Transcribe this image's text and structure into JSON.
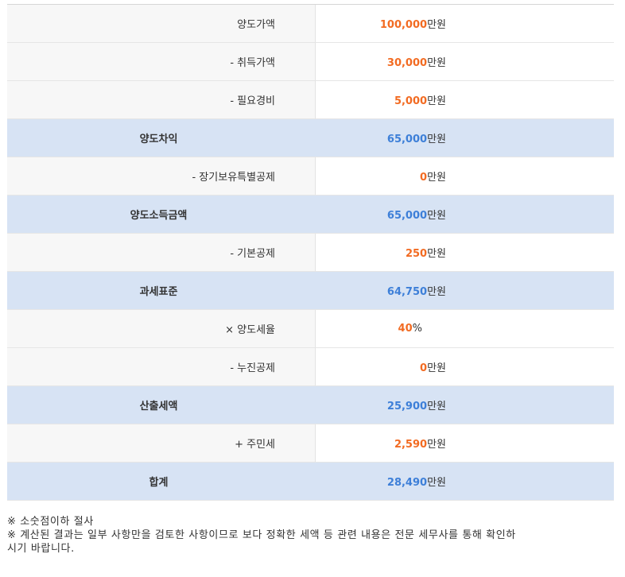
{
  "rows": [
    {
      "label": "양도가액",
      "value": "100,000",
      "unit": "만원",
      "color": "#f26b22",
      "summary": false
    },
    {
      "label": "- 취득가액",
      "value": "30,000",
      "unit": "만원",
      "color": "#f26b22",
      "summary": false
    },
    {
      "label": "- 필요경비",
      "value": "5,000",
      "unit": "만원",
      "color": "#f26b22",
      "summary": false
    },
    {
      "label": "양도차익",
      "value": "65,000",
      "unit": "만원",
      "color": "#3d7fd8",
      "summary": true
    },
    {
      "label": "- 장기보유특별공제",
      "value": "0",
      "unit": "만원",
      "color": "#f26b22",
      "summary": false
    },
    {
      "label": "양도소득금액",
      "value": "65,000",
      "unit": "만원",
      "color": "#3d7fd8",
      "summary": true
    },
    {
      "label": "- 기본공제",
      "value": "250",
      "unit": "만원",
      "color": "#f26b22",
      "summary": false
    },
    {
      "label": "과세표준",
      "value": "64,750",
      "unit": "만원",
      "color": "#3d7fd8",
      "summary": true
    },
    {
      "label": "× 양도세율",
      "value": "40",
      "unit": "%",
      "color": "#f26b22",
      "summary": false
    },
    {
      "label": "- 누진공제",
      "value": "0",
      "unit": "만원",
      "color": "#f26b22",
      "summary": false
    },
    {
      "label": "산출세액",
      "value": "25,900",
      "unit": "만원",
      "color": "#3d7fd8",
      "summary": true
    },
    {
      "label": "+ 주민세",
      "value": "2,590",
      "unit": "만원",
      "color": "#f26b22",
      "summary": false
    },
    {
      "label": "합계",
      "value": "28,490",
      "unit": "만원",
      "color": "#3d7fd8",
      "summary": true
    }
  ],
  "notes": {
    "line1": "※ 소숫점이하 절사",
    "line2": "※ 계산된 결과는 일부 사항만을 검토한 사항이므로 보다 정확한 세액 등 관련 내용은 전문 세무사를 통해 확인하",
    "line3": "시기 바랍니다."
  }
}
